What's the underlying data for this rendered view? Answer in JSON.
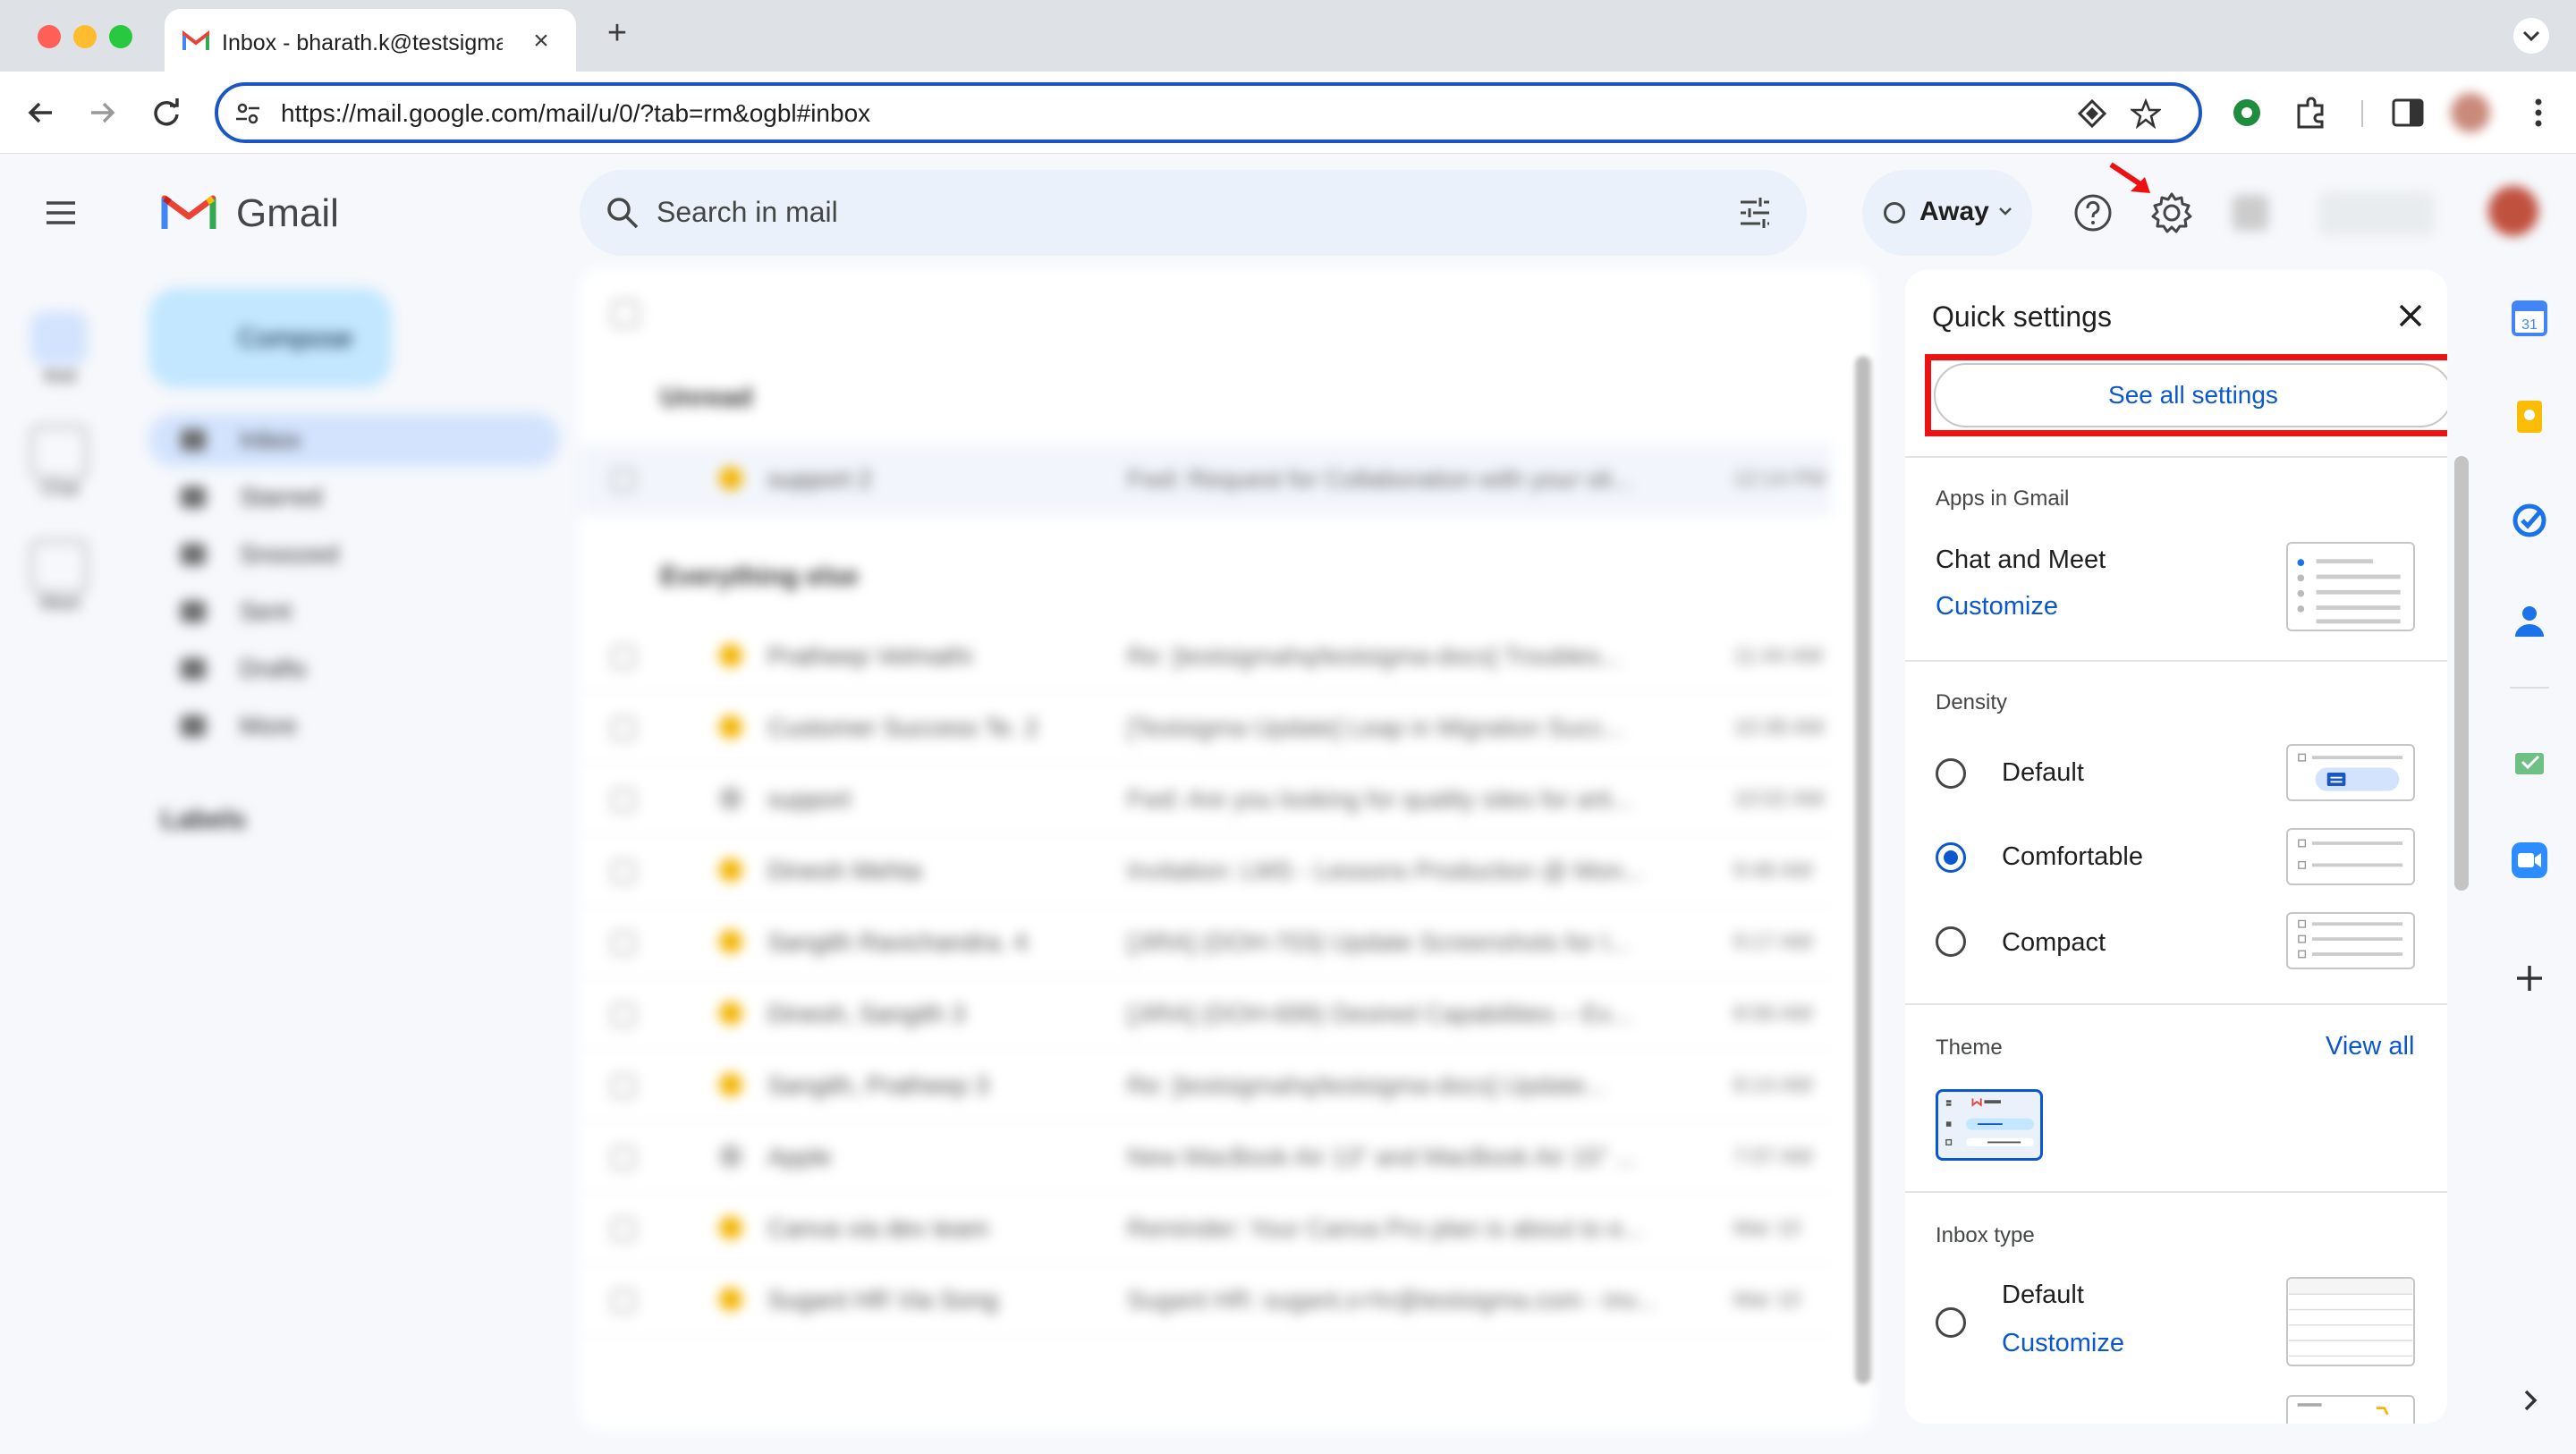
{
  "browser": {
    "tab_title": "Inbox - bharath.k@testsigma",
    "url": "https://mail.google.com/mail/u/0/?tab=rm&ogbl#inbox"
  },
  "gmail": {
    "brand": "Gmail",
    "search_placeholder": "Search in mail",
    "status": "Away"
  },
  "quick_settings": {
    "title": "Quick settings",
    "see_all": "See all settings",
    "apps_heading": "Apps in Gmail",
    "chat_meet": "Chat and Meet",
    "customize": "Customize",
    "density_heading": "Density",
    "density_options": [
      {
        "label": "Default",
        "selected": false
      },
      {
        "label": "Comfortable",
        "selected": true
      },
      {
        "label": "Compact",
        "selected": false
      }
    ],
    "theme_heading": "Theme",
    "view_all": "View all",
    "inbox_type_heading": "Inbox type",
    "inbox_default": "Default",
    "inbox_customize": "Customize"
  },
  "blurred": {
    "compose": "Compose",
    "nav": [
      "Inbox",
      "Starred",
      "Snoozed",
      "Sent",
      "Drafts",
      "More"
    ],
    "labels": "Labels",
    "rail": [
      "Mail",
      "Chat",
      "Meet"
    ],
    "sections": [
      "Unread",
      "Everything else"
    ],
    "rows": [
      {
        "sender": "support 2",
        "subject": "Fwd: Request for Collaboration with your sit...",
        "date": "12:14 PM"
      },
      {
        "sender": "Pratheep Velmathi",
        "subject": "Re: [testsigmahq/testsigma-docs] Troubles...",
        "date": "11:44 AM"
      },
      {
        "sender": "Customer Success Te. 2",
        "subject": "[Testsigma Update] Leap in Migration Succ...",
        "date": "10:38 AM"
      },
      {
        "sender": "support",
        "subject": "Fwd: Are you looking for quality sites for arti...",
        "date": "10:02 AM"
      },
      {
        "sender": "Dinesh Mehta",
        "subject": "Invitation: LMS - Lessons Production @ Mon...",
        "date": "9:48 AM"
      },
      {
        "sender": "Sangith Ravichandra. 4",
        "subject": "[JIRA] (DOH-703) Update Screenshots for I...",
        "date": "9:17 AM"
      },
      {
        "sender": "Dinesh, Sangith 3",
        "subject": "[JIRA] (DOH-699) Desired Capabilities – Ex...",
        "date": "8:56 AM"
      },
      {
        "sender": "Sangith, Pratheep 3",
        "subject": "Re: [testsigmahq/testsigma-docs] Update...",
        "date": "8:14 AM"
      },
      {
        "sender": "Apple",
        "subject": "New MacBook Air 13\" and MacBook Air 15\" ...",
        "date": "7:07 AM"
      },
      {
        "sender": "Canva via dev team",
        "subject": "Reminder: Your Canva Pro plan is about to e...",
        "date": "Mar 10"
      },
      {
        "sender": "Sugant HR Via Song",
        "subject": "Sugant HR: sugant.s+hr@testsigma.com - inv...",
        "date": "Mar 10"
      }
    ]
  }
}
